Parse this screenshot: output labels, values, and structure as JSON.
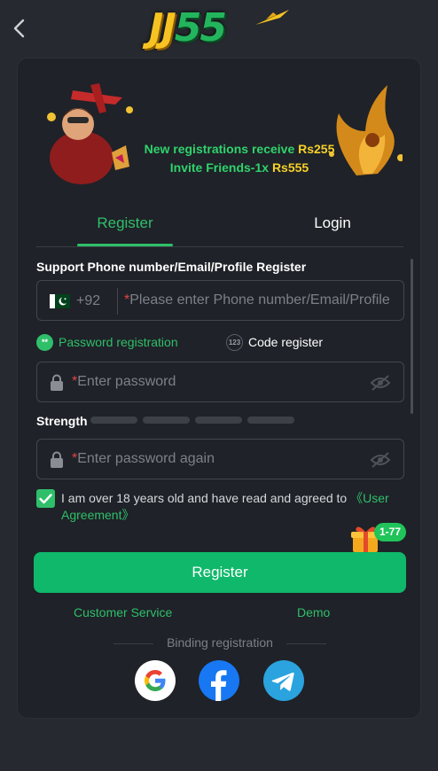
{
  "header": {
    "back_icon": "chevron-left-icon",
    "logo_text_jj": "JJ",
    "logo_text_num": "55"
  },
  "banner": {
    "line1_text": "New registrations receive ",
    "line1_amount": "Rs255",
    "line2_text": "Invite Friends-1x ",
    "line2_amount": "Rs555"
  },
  "tabs": [
    {
      "label": "Register",
      "active": true
    },
    {
      "label": "Login",
      "active": false
    }
  ],
  "form": {
    "section_title": "Support Phone number/Email/Profile Register",
    "country_code": "+92",
    "phone_placeholder": "Please enter Phone number/Email/Profile",
    "mode_password": "Password registration",
    "mode_password_icon": "**",
    "mode_code": "Code register",
    "mode_code_icon": "123",
    "password_placeholder": "Enter password",
    "strength_label": "Strength",
    "strength_level": 0,
    "password_again_placeholder": "Enter password again",
    "required_mark": "*"
  },
  "agreement": {
    "checked": true,
    "text": "I am over 18 years old and have read and agreed to ",
    "link": "《User Agreement》"
  },
  "promo_badge": "1-77",
  "register_button": "Register",
  "links": {
    "customer_service": "Customer Service",
    "demo": "Demo"
  },
  "binding_label": "Binding registration",
  "social": [
    "google-icon",
    "facebook-icon",
    "telegram-icon"
  ],
  "colors": {
    "accent": "#2fbf6a",
    "button": "#0fb86a",
    "background": "#26292f",
    "card": "#1f2228"
  }
}
